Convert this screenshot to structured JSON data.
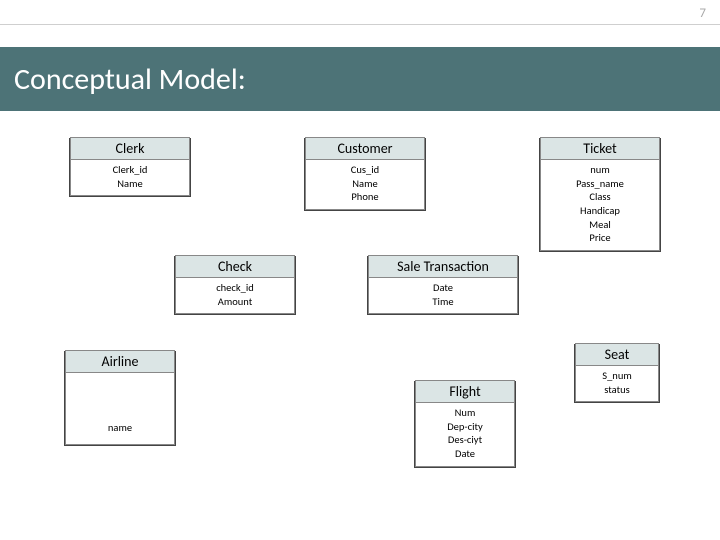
{
  "page_number": "7",
  "title": "Conceptual Model:",
  "colors": {
    "bar": "#4d7377",
    "entity_header": "#dbe5e5"
  },
  "entities": {
    "clerk": {
      "name": "Clerk",
      "attrs": [
        "Clerk_id",
        "Name"
      ]
    },
    "customer": {
      "name": "Customer",
      "attrs": [
        "Cus_id",
        "Name",
        "Phone"
      ]
    },
    "ticket": {
      "name": "Ticket",
      "attrs": [
        "num",
        "Pass_name",
        "Class",
        "Handicap",
        "Meal",
        "Price"
      ]
    },
    "check": {
      "name": "Check",
      "attrs": [
        "check_id",
        "Amount"
      ]
    },
    "sale": {
      "name": "Sale Transaction",
      "attrs": [
        "Date",
        "Time"
      ]
    },
    "airline": {
      "name": "Airline",
      "attrs": [
        "name"
      ]
    },
    "seat": {
      "name": "Seat",
      "attrs": [
        "S_num",
        "status"
      ]
    },
    "flight": {
      "name": "Flight",
      "attrs": [
        "Num",
        "Dep-city",
        "Des-ciyt",
        "Date"
      ]
    }
  }
}
